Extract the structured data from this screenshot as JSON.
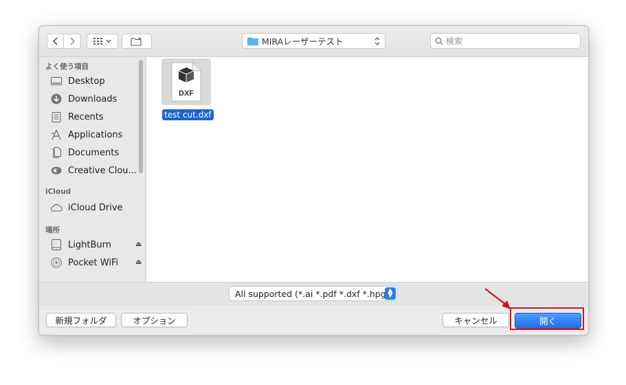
{
  "toolbar": {
    "path_label": "MIRAレーザーテスト",
    "search_placeholder": "検索"
  },
  "sidebar": {
    "sections": [
      {
        "title": "よく使う項目"
      },
      {
        "title": "iCloud"
      },
      {
        "title": "場所"
      }
    ],
    "items": [
      {
        "label": "Desktop",
        "icon": "desktop-icon"
      },
      {
        "label": "Downloads",
        "icon": "downloads-icon"
      },
      {
        "label": "Recents",
        "icon": "recents-icon"
      },
      {
        "label": "Applications",
        "icon": "applications-icon"
      },
      {
        "label": "Documents",
        "icon": "documents-icon"
      },
      {
        "label": "Creative Clou...",
        "icon": "creative-cloud-icon"
      },
      {
        "label": "iCloud Drive",
        "icon": "cloud-icon"
      },
      {
        "label": "LightBurn",
        "icon": "drive-icon"
      },
      {
        "label": "Pocket WiFi",
        "icon": "disc-icon"
      }
    ]
  },
  "file": {
    "name": "test cut.dxf",
    "type_label": "DXF"
  },
  "filter": {
    "selected": "All supported (*.ai *.pdf *.dxf *.hpgl..."
  },
  "buttons": {
    "new_folder": "新規フォルダ",
    "options": "オプション",
    "cancel": "キャンセル",
    "open": "開く"
  },
  "colors": {
    "accent": "#1a63d6",
    "highlight_box": "#c8171d"
  }
}
